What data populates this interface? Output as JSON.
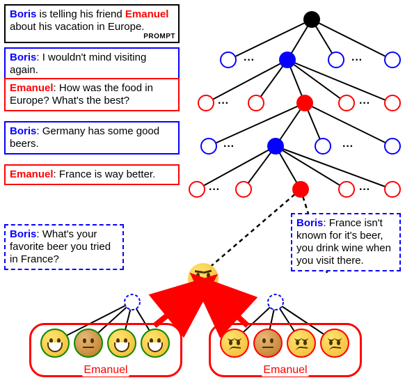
{
  "prompt": {
    "text_prefix": "Boris",
    "text_mid": " is telling his friend ",
    "text_friend": "Emanuel",
    "text_suffix": " about his vacation in Europe.",
    "tag": "PROMPT"
  },
  "turns": [
    {
      "speaker": "Boris",
      "speaker_class": "boris",
      "text": "I wouldn't mind visiting again."
    },
    {
      "speaker": "Emanuel",
      "speaker_class": "emanuel",
      "text": "How was the food in Europe? What's the best?"
    },
    {
      "speaker": "Boris",
      "speaker_class": "boris",
      "text": "Germany has some good beers."
    },
    {
      "speaker": "Emanuel",
      "speaker_class": "emanuel",
      "text": "France is way better."
    }
  ],
  "candidates": {
    "left": {
      "speaker": "Boris",
      "text": "What's your favorite beer you tried in France?"
    },
    "right": {
      "speaker": "Boris",
      "text": "France isn't known for it's beer, you drink wine when you visit there."
    }
  },
  "rater_label": "Emanuel",
  "ellipsis": "· · ·",
  "colors": {
    "boris": "#0700ff",
    "emanuel": "#ff0000",
    "positive_ring": "#0a8a00",
    "negative_ring": "#ff0000"
  },
  "icons": {
    "root": "black-circle",
    "boris_node": "blue-circle",
    "emanuel_node": "red-circle",
    "boris_open": "blue-open-circle",
    "emanuel_open": "red-open-circle",
    "candidate_node": "blue-dashed-open-circle",
    "thinking": "thinking-face-emoji",
    "grin": "grinning-face-emoji",
    "neutral": "neutral-face-emoji",
    "unamused": "unamused-face-emoji",
    "arrow_up": "red-up-arrow"
  },
  "ratings": {
    "left": [
      "grin",
      "neutral-dark",
      "grin",
      "grin"
    ],
    "right": [
      "unamused",
      "neutral-dark",
      "unamused",
      "unamused"
    ]
  }
}
